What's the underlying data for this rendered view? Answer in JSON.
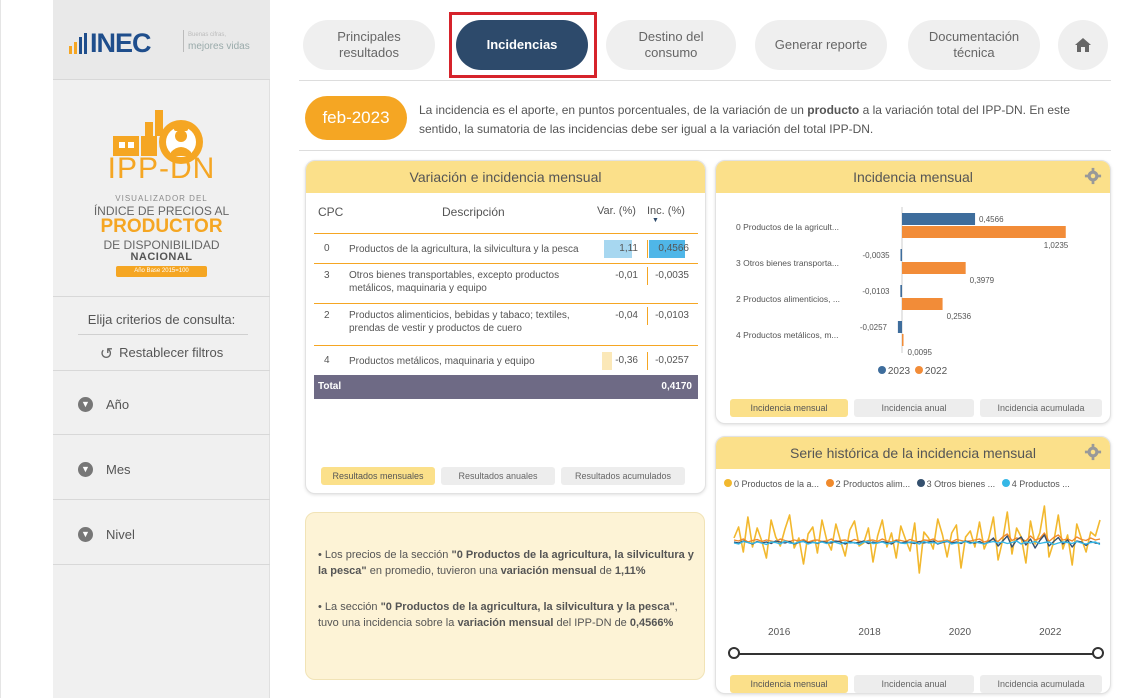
{
  "brand": {
    "name": "INEC",
    "tagline_top": "Buenas cifras,",
    "tagline_bottom": "mejores vidas"
  },
  "product": {
    "title": "IPP-DN",
    "sub1": "VISUALIZADOR DEL",
    "sub2": "ÍNDICE DE PRECIOS AL",
    "sub3": "PRODUCTOR",
    "sub4": "DE DISPONIBILIDAD",
    "sub5": "NACIONAL",
    "base": "Año Base 2015=100"
  },
  "sidebar": {
    "criteria_label": "Elija criterios de consulta:",
    "reset_label": "Restablecer filtros",
    "filters": [
      {
        "label": "Año"
      },
      {
        "label": "Mes"
      },
      {
        "label": "Nivel"
      }
    ]
  },
  "nav": {
    "items": [
      {
        "label": "Principales resultados"
      },
      {
        "label": "Incidencias"
      },
      {
        "label": "Destino del consumo"
      },
      {
        "label": "Generar reporte"
      },
      {
        "label": "Documentación técnica"
      }
    ],
    "active_index": 1,
    "home_icon": "home-icon"
  },
  "period": "feb-2023",
  "intro": {
    "before": "La incidencia es el aporte, en puntos porcentuales, de la variación de un ",
    "bold": "producto",
    "after": " a la variación total del IPP-DN. En este sentido, la sumatoria de las incidencias debe ser igual a la variación del total IPP-DN."
  },
  "table_panel": {
    "title": "Variación e incidencia mensual",
    "headers": {
      "cpc": "CPC",
      "desc": "Descripción",
      "var": "Var. (%)",
      "inc": "Inc. (%)"
    },
    "rows": [
      {
        "cpc": "0",
        "desc": "Productos de la agricultura, la silvicultura y la pesca",
        "var": "1,11",
        "inc": "0,4566"
      },
      {
        "cpc": "3",
        "desc": "Otros bienes transportables, excepto productos metálicos, maquinaria y equipo",
        "var": "-0,01",
        "inc": "-0,0035"
      },
      {
        "cpc": "2",
        "desc": "Productos alimenticios, bebidas y tabaco; textiles, prendas de vestir y productos de cuero",
        "var": "-0,04",
        "inc": "-0,0103"
      },
      {
        "cpc": "4",
        "desc": "Productos metálicos, maquinaria y equipo",
        "var": "-0,36",
        "inc": "-0,0257"
      }
    ],
    "total_label": "Total",
    "total_value": "0,4170",
    "buttons": [
      "Resultados mensuales",
      "Resultados anuales",
      "Resultados acumulados"
    ],
    "active_button": 0
  },
  "summary": {
    "b1_pre": "• Los precios de la sección ",
    "b1_bold1": "\"0 Productos de la agricultura, la silvicultura y la pesca\"",
    "b1_mid": " en promedio, tuvieron una ",
    "b1_bold2": "variación mensual",
    "b1_post": " de ",
    "b1_val": "1,11%",
    "b2_pre": "• La sección ",
    "b2_bold1": "\"0 Productos de la agricultura, la silvicultura y la pesca\"",
    "b2_mid": ", tuvo una incidencia sobre la ",
    "b2_bold2": "variación mensual",
    "b2_post": " del IPP-DN de ",
    "b2_val": "0,4566%"
  },
  "inc_panel": {
    "title": "Incidencia mensual",
    "gear_icon": "gear-icon",
    "buttons": [
      "Incidencia mensual",
      "Incidencia anual",
      "Incidencia acumulada"
    ],
    "active_button": 0
  },
  "serie_panel": {
    "title": "Serie histórica de la incidencia mensual",
    "gear_icon": "gear-icon",
    "legend": [
      {
        "name": "0 Productos de la a...",
        "color": "#f2b82e"
      },
      {
        "name": "2 Productos alim...",
        "color": "#f08a2c"
      },
      {
        "name": "3 Otros bienes ...",
        "color": "#34506e"
      },
      {
        "name": "4 Productos ...",
        "color": "#35b7e6"
      }
    ],
    "buttons": [
      "Incidencia mensual",
      "Incidencia anual",
      "Incidencia acumulada"
    ],
    "active_button": 0
  },
  "colors": {
    "accent": "#f5a623",
    "nav_active": "#2d4a6b",
    "series_2023": "#3e6d9c",
    "series_2022": "#f28c38",
    "highlight_border": "#d6232b"
  },
  "chart_data": [
    {
      "type": "bar",
      "orientation": "horizontal",
      "categories": [
        "0 Productos de la agricult...",
        "3 Otros bienes transporta...",
        "2 Productos alimenticios, ...",
        "4 Productos metálicos, m..."
      ],
      "series": [
        {
          "name": "2023",
          "values": [
            0.4566,
            -0.0035,
            -0.0103,
            -0.0257
          ],
          "labels": [
            "0,4566",
            "-0,0035",
            "-0,0103",
            "-0,0257"
          ]
        },
        {
          "name": "2022",
          "values": [
            1.0235,
            0.3979,
            0.2536,
            0.0095
          ],
          "labels": [
            "1,0235",
            "0,3979",
            "0,2536",
            "0,0095"
          ]
        }
      ],
      "legend": "bottom"
    },
    {
      "type": "line",
      "x_ticks": [
        "2016",
        "2018",
        "2020",
        "2022"
      ],
      "xlim": [
        2015,
        2023.1
      ],
      "series": [
        {
          "name": "0 Productos de la a...",
          "values": [
            0.1,
            0.32,
            -0.18,
            0.52,
            -0.08,
            0.3,
            0.04,
            -0.3,
            0.46,
            0.12,
            -0.06,
            0.28,
            0.56,
            -0.1,
            0.1,
            -0.42,
            0.18,
            0.32,
            -0.2,
            0.46,
            0.06,
            -0.14,
            0.38,
            0.04,
            -0.26,
            0.26,
            0.44,
            -0.06,
            0.0,
            0.3,
            -0.38,
            0.14,
            0.46,
            -0.08,
            0.2,
            -0.3,
            0.34,
            0.08,
            -0.16,
            0.4,
            -0.6,
            0.22,
            0.1,
            -0.12,
            0.48,
            0.16,
            -0.28,
            0.2,
            0.36,
            -0.5,
            0.12,
            0.24,
            -0.08,
            0.42,
            -0.12,
            0.1,
            0.52,
            -0.34,
            0.06,
            0.62,
            -0.22,
            0.3,
            0.12,
            -0.4,
            0.44,
            -0.02,
            0.2,
            0.74,
            -0.28,
            0.02,
            0.56,
            -0.12,
            0.16,
            -0.44,
            0.38,
            0.08,
            -0.18,
            0.22,
            0.14,
            0.46
          ]
        },
        {
          "name": "2 Productos alim...",
          "values": [
            0.06,
            0.04,
            0.08,
            0.02,
            0.05,
            0.07,
            0.03,
            0.06,
            0.04,
            0.02,
            0.08,
            0.05,
            0.03,
            0.06,
            0.04,
            0.07,
            0.02,
            0.05,
            0.06,
            0.03,
            0.04,
            0.08,
            0.02,
            0.05,
            0.06,
            0.03,
            0.07,
            0.04,
            0.02,
            0.05,
            0.06,
            0.03,
            0.08,
            0.04,
            0.02,
            0.06,
            0.05,
            0.03,
            0.07,
            0.04,
            0.02,
            0.06,
            0.05,
            0.08,
            0.03,
            0.04,
            0.06,
            0.02,
            0.07,
            0.05,
            0.03,
            0.04,
            0.06,
            0.08,
            0.02,
            0.05,
            0.07,
            0.03,
            0.12,
            0.18,
            0.05,
            0.1,
            0.08,
            0.04,
            0.14,
            0.06,
            0.09,
            0.2,
            0.03,
            0.11,
            0.16,
            0.06,
            0.08,
            0.04,
            0.12,
            0.07,
            0.05,
            0.1,
            0.06,
            0.08
          ]
        },
        {
          "name": "3 Otros bienes ...",
          "values": [
            0.02,
            0.0,
            0.04,
            0.01,
            -0.02,
            0.03,
            0.0,
            0.02,
            -0.01,
            0.04,
            0.02,
            0.0,
            0.03,
            -0.02,
            0.01,
            0.04,
            0.0,
            0.02,
            -0.01,
            0.03,
            0.01,
            0.0,
            0.04,
            0.02,
            -0.02,
            0.03,
            0.0,
            0.01,
            0.04,
            -0.01,
            0.02,
            0.0,
            0.03,
            0.01,
            -0.02,
            0.04,
            0.0,
            0.02,
            0.01,
            -0.01,
            0.03,
            0.0,
            0.02,
            0.04,
            -0.02,
            0.01,
            0.03,
            0.0,
            0.02,
            -0.01,
            0.04,
            0.01,
            0.0,
            0.03,
            -0.02,
            0.02,
            0.1,
            -0.06,
            0.04,
            0.14,
            -0.08,
            0.06,
            0.12,
            -0.04,
            0.08,
            -0.1,
            0.05,
            0.16,
            -0.06,
            0.03,
            0.11,
            -0.02,
            0.06,
            -0.08,
            0.04,
            0.02,
            -0.05,
            0.03,
            0.0,
            -0.01
          ]
        },
        {
          "name": "4 Productos ...",
          "values": [
            0.0,
            -0.02,
            0.03,
            0.01,
            -0.01,
            0.02,
            0.0,
            -0.03,
            0.02,
            0.01,
            -0.02,
            0.04,
            0.0,
            -0.01,
            0.02,
            0.03,
            -0.02,
            0.01,
            0.0,
            0.02,
            -0.01,
            0.03,
            0.01,
            -0.02,
            0.02,
            0.0,
            0.01,
            -0.03,
            0.02,
            0.03,
            -0.01,
            0.0,
            0.02,
            -0.02,
            0.01,
            0.03,
            0.0,
            -0.01,
            0.02,
            0.01,
            -0.02,
            0.03,
            0.0,
            0.01,
            -0.01,
            0.02,
            0.04,
            -0.02,
            0.0,
            0.01,
            0.03,
            -0.01,
            0.02,
            0.0,
            -0.02,
            0.01,
            0.03,
            0.0,
            0.02,
            -0.01,
            0.01,
            0.04,
            -0.02,
            0.02,
            0.0,
            0.03,
            -0.01,
            0.01,
            0.02,
            -0.03,
            0.0,
            0.02,
            0.01,
            -0.01,
            0.03,
            0.0,
            -0.02,
            0.01,
            0.02,
            -0.03
          ]
        }
      ],
      "legend": "top"
    }
  ]
}
